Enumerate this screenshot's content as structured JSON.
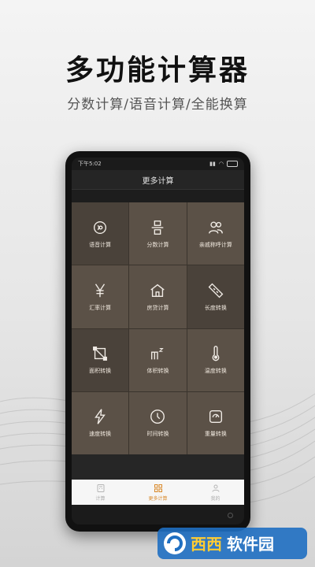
{
  "promo": {
    "headline": "多功能计算器",
    "subline": "分数计算/语音计算/全能换算"
  },
  "statusbar": {
    "time": "下午5:02",
    "battery": "88"
  },
  "screen": {
    "title": "更多计算"
  },
  "grid_items": [
    {
      "label": "语音计算",
      "icon": "voice-icon"
    },
    {
      "label": "分数计算",
      "icon": "fraction-icon"
    },
    {
      "label": "亲戚称呼计算",
      "icon": "relatives-icon"
    },
    {
      "label": "汇率计算",
      "icon": "yen-icon"
    },
    {
      "label": "房贷计算",
      "icon": "house-icon"
    },
    {
      "label": "长度转换",
      "icon": "ruler-icon"
    },
    {
      "label": "面积转换",
      "icon": "area-icon"
    },
    {
      "label": "体积转换",
      "icon": "volume-icon"
    },
    {
      "label": "温度转换",
      "icon": "thermometer-icon"
    },
    {
      "label": "速度转换",
      "icon": "lightning-icon"
    },
    {
      "label": "时间转换",
      "icon": "clock-icon"
    },
    {
      "label": "重量转换",
      "icon": "scale-icon"
    }
  ],
  "tabs": [
    {
      "label": "计算",
      "icon": "calculator-icon",
      "active": false
    },
    {
      "label": "更多计算",
      "icon": "grid-icon",
      "active": true
    },
    {
      "label": "我的",
      "icon": "person-icon",
      "active": false
    }
  ],
  "watermark": {
    "text": "西西软件园",
    "sub": "CR173.COM"
  },
  "colors": {
    "accent": "#d9892b",
    "tile": "#5b5147"
  }
}
